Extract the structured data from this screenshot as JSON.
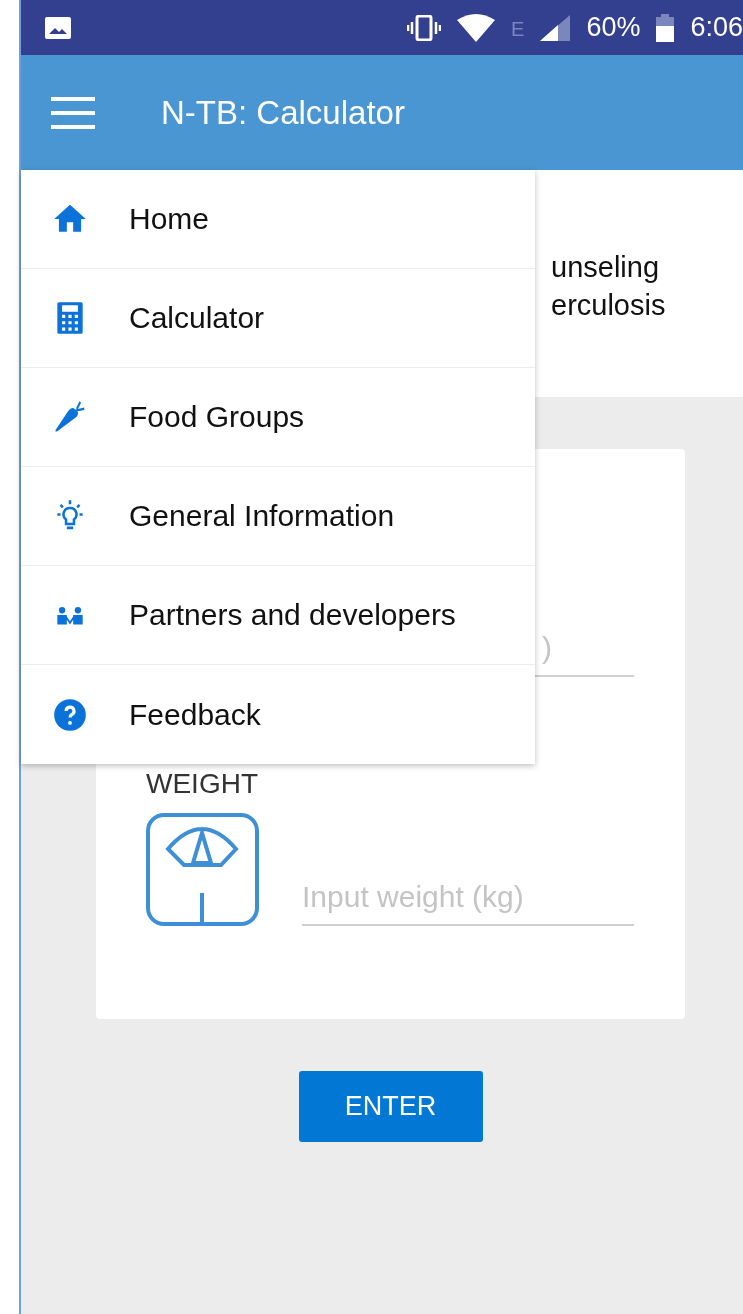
{
  "status_bar": {
    "network": "E",
    "battery": "60%",
    "time": "6:06"
  },
  "app_bar": {
    "title": "N-TB: Calculator"
  },
  "header": {
    "lines": [
      "unseling",
      "erculosis"
    ]
  },
  "form": {
    "height_field": {
      "placeholder": ")"
    },
    "weight": {
      "label": "WEIGHT",
      "placeholder": "Input weight (kg)"
    }
  },
  "button": "ENTER",
  "drawer": {
    "items": [
      {
        "label": "Home",
        "kind": "home"
      },
      {
        "label": "Calculator",
        "kind": "calculator"
      },
      {
        "label": "Food Groups",
        "kind": "food"
      },
      {
        "label": "General Information",
        "kind": "info"
      },
      {
        "label": "Partners and developers",
        "kind": "partners"
      },
      {
        "label": "Feedback",
        "kind": "feedback"
      }
    ]
  }
}
